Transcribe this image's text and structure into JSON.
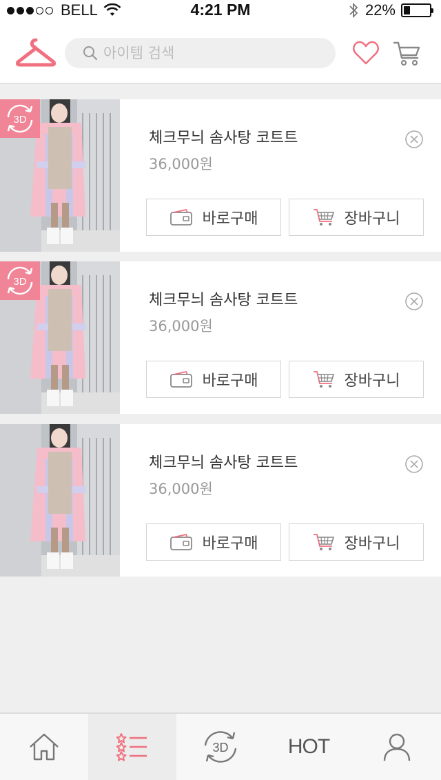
{
  "status_bar": {
    "carrier": "BELL",
    "time": "4:21 PM",
    "battery_percent": "22%",
    "battery_level": 0.22,
    "signal_dots_filled": 3,
    "signal_dots_total": 5
  },
  "header": {
    "search_placeholder": "아이템 검색",
    "logo_icon": "hanger-icon",
    "wishlist_icon": "heart-icon",
    "cart_icon": "cart-icon"
  },
  "colors": {
    "accent": "#f0707f",
    "badge": "#f6788c",
    "background": "#efefef"
  },
  "items": [
    {
      "name": "체크무늬 솜사탕 코트트",
      "price": "36,000원",
      "buy_label": "바로구매",
      "cart_label": "장바구니",
      "badge": "3D"
    },
    {
      "name": "체크무늬 솜사탕 코트트",
      "price": "36,000원",
      "buy_label": "바로구매",
      "cart_label": "장바구니",
      "badge": "3D"
    },
    {
      "name": "체크무늬 솜사탕 코트트",
      "price": "36,000원",
      "buy_label": "바로구매",
      "cart_label": "장바구니",
      "badge": ""
    }
  ],
  "bottom_nav": {
    "items": [
      {
        "icon": "home-icon",
        "label": ""
      },
      {
        "icon": "star-list-icon",
        "label": "",
        "active": true
      },
      {
        "icon": "rotate-3d-icon",
        "label": "3D"
      },
      {
        "icon": "",
        "label": "HOT"
      },
      {
        "icon": "user-icon",
        "label": ""
      }
    ]
  }
}
